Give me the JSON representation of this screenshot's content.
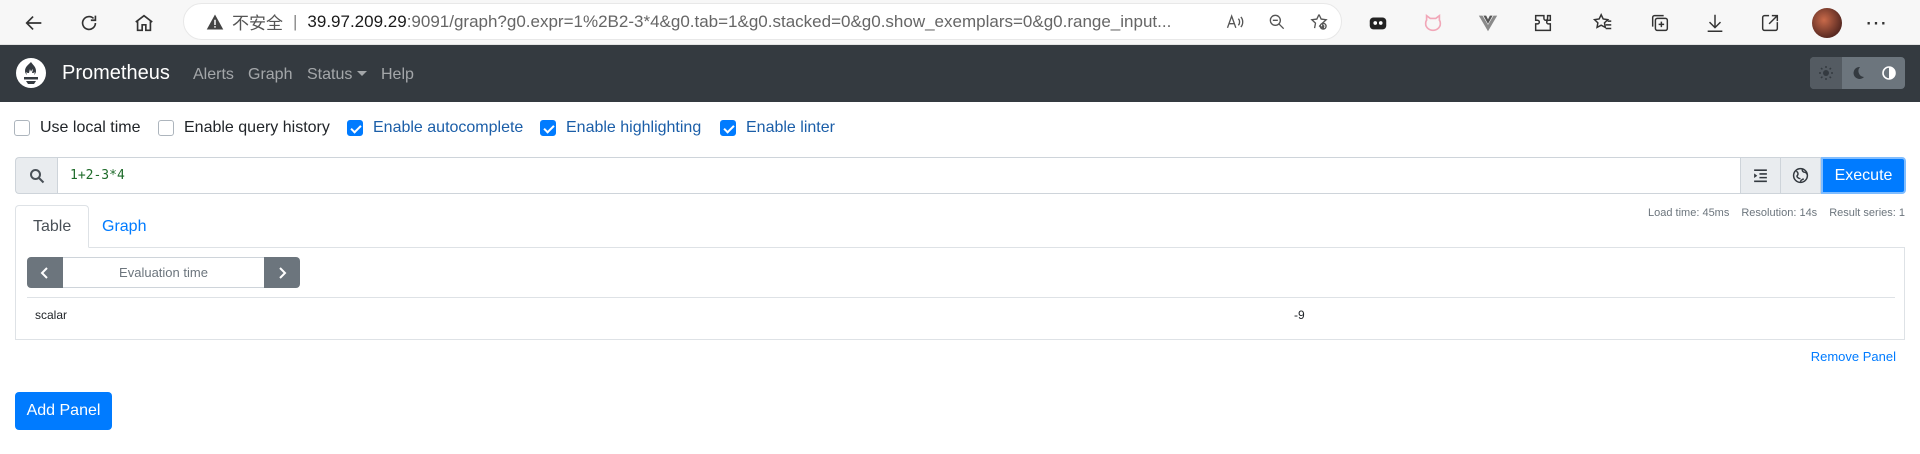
{
  "browser": {
    "url_insecure_label": "不安全",
    "url_separator": "|",
    "url_host": "39.97.209.29",
    "url_rest": ":9091/graph?g0.expr=1%2B2-3*4&g0.tab=1&g0.stacked=0&g0.show_exemplars=0&g0.range_input..."
  },
  "navbar": {
    "brand": "Prometheus",
    "links": [
      "Alerts",
      "Graph",
      "Status",
      "Help"
    ]
  },
  "options": [
    {
      "label": "Use local time",
      "checked": false
    },
    {
      "label": "Enable query history",
      "checked": false
    },
    {
      "label": "Enable autocomplete",
      "checked": true
    },
    {
      "label": "Enable highlighting",
      "checked": true
    },
    {
      "label": "Enable linter",
      "checked": true
    }
  ],
  "query": {
    "expression": "1+2-3*4",
    "execute_label": "Execute"
  },
  "tabs": [
    "Table",
    "Graph"
  ],
  "stats": {
    "load_time": "Load time: 45ms",
    "resolution": "Resolution: 14s",
    "result_series": "Result series: 1"
  },
  "table": {
    "eval_placeholder": "Evaluation time",
    "rows": [
      {
        "name": "scalar",
        "value": "-9"
      }
    ]
  },
  "panel": {
    "remove_label": "Remove Panel",
    "add_label": "Add Panel"
  },
  "colors": {
    "navbar_bg": "#343a40",
    "primary": "#007bff",
    "secondary": "#6c757d"
  }
}
